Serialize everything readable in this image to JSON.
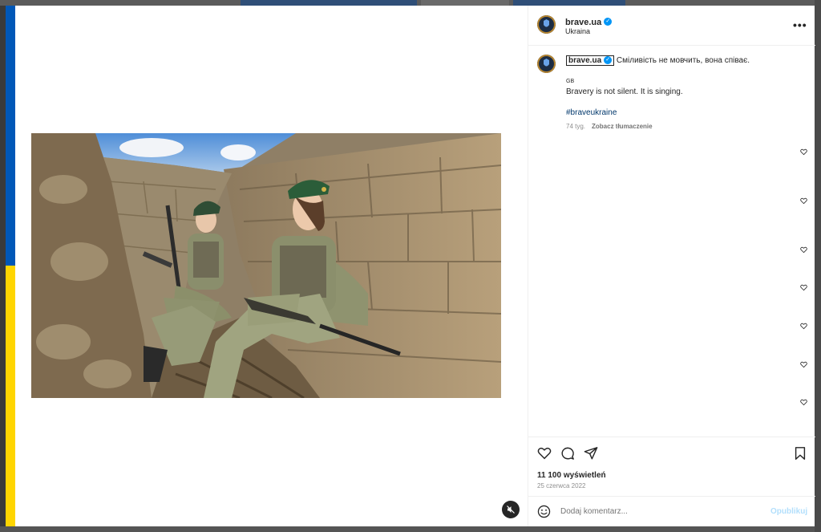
{
  "post": {
    "username": "brave.ua",
    "location": "Ukraina",
    "caption_text": "Сміливість не мовчить, вона співає.",
    "translation_flag": "GB",
    "caption_translation": "Bravery is not silent. It is singing.",
    "hashtag": "#braveukraine",
    "caption_age": "74 tyg.",
    "see_translation": "Zobacz tłumaczenie",
    "views": "11 100 wyświetleń",
    "date": "25 czerwca 2022"
  },
  "comment_box": {
    "placeholder": "Dodaj komentarz...",
    "post_label": "Opublikuj"
  },
  "icons": {
    "more": "more-horizontal-icon",
    "verified": "verified-badge-icon",
    "like": "heart-icon",
    "comment": "comment-bubble-icon",
    "share": "paper-plane-icon",
    "save": "bookmark-icon",
    "emoji": "emoji-smile-icon",
    "mute": "speaker-muted-icon"
  },
  "colors": {
    "flag_blue": "#0057b7",
    "flag_yellow": "#ffd500",
    "verified": "#0095f6",
    "hashtag": "#00376b",
    "post_button_disabled": "#b2dffc"
  }
}
